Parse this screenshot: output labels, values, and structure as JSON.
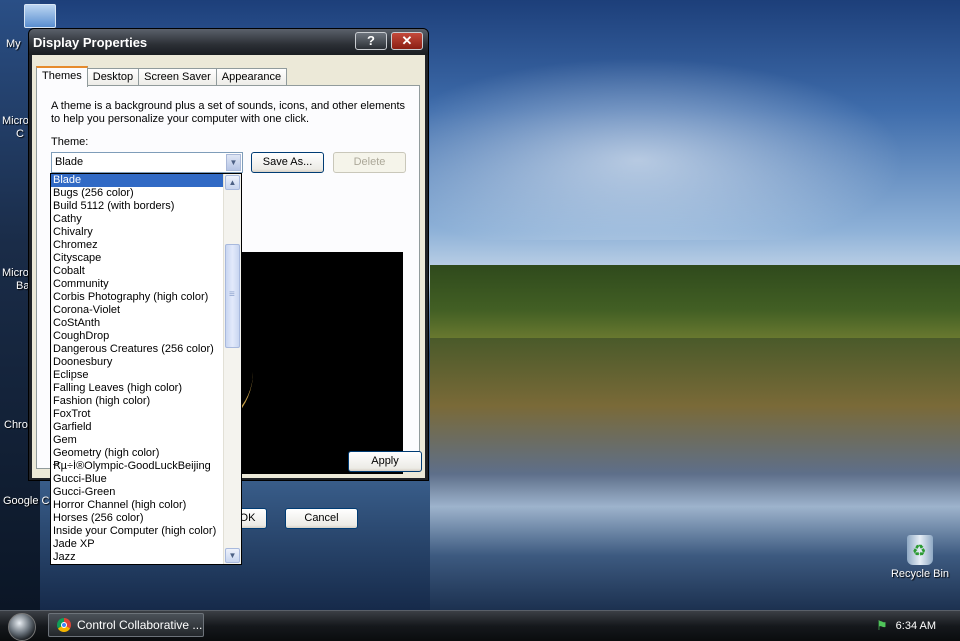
{
  "desktop": {
    "icons": [
      {
        "label": "My"
      },
      {
        "label": "Micro"
      },
      {
        "label": "C"
      },
      {
        "label": "Micro"
      },
      {
        "label": "Ba"
      },
      {
        "label": "Chro"
      },
      {
        "label": "Google Ch"
      }
    ],
    "recycle_bin": {
      "label": "Recycle Bin"
    }
  },
  "window": {
    "title": "Display Properties",
    "help_button": "?",
    "close_button": "✕",
    "tabs": [
      {
        "label": "Themes",
        "active": true
      },
      {
        "label": "Desktop"
      },
      {
        "label": "Screen Saver"
      },
      {
        "label": "Appearance"
      }
    ],
    "description": "A theme is a background plus a set of sounds, icons, and other elements to help you personalize your computer with one click.",
    "theme_label": "Theme:",
    "theme_value": "Blade",
    "save_as": "Save As...",
    "delete": "Delete",
    "ok": "OK",
    "cancel": "Cancel",
    "apply": "Apply"
  },
  "theme_list": [
    "Blade",
    "Bugs (256 color)",
    "Build 5112 (with borders)",
    "Cathy",
    "Chivalry",
    "Chromez",
    "Cityscape",
    "Cobalt",
    "Community",
    "Corbis Photography (high color)",
    "Corona-Violet",
    "CoStAnth",
    "CoughDrop",
    "Dangerous Creatures (256 color)",
    "Doonesbury",
    "Eclipse",
    "Falling Leaves (high color)",
    "Fashion (high color)",
    "FoxTrot",
    "Garfield",
    "Gem",
    "Geometry (high color)",
    "Ꞧµ÷Í®Olympic-GoodLuckBeijing",
    "Gucci-Blue",
    "Gucci-Green",
    "Horror Channel (high color)",
    "Horses (256 color)",
    "Inside your Computer (high color)",
    "Jade XP",
    "Jazz"
  ],
  "taskbar": {
    "task_label": "Control Collaborative ...",
    "clock": "6:34 AM"
  }
}
